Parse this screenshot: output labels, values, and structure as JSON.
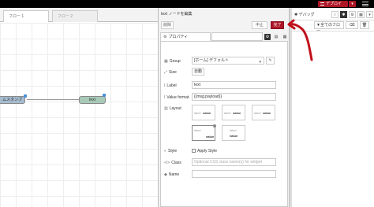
{
  "header": {
    "deploy_label": "デプロイ",
    "deploy_menu_icon": "caret-down-icon",
    "menu_icon": "hamburger-icon"
  },
  "workspace": {
    "tabs": [
      "フロー 1",
      "フロー 2"
    ],
    "nodes": {
      "inject_label": "ムスタンプ",
      "text_label": "text"
    }
  },
  "editor": {
    "title": "text ノードを編集",
    "delete_label": "削除",
    "cancel_label": "中止",
    "done_label": "完了",
    "properties_tab": "プロパティ",
    "fields": {
      "group_label": "Group",
      "group_value": "[ホーム] デフォルト",
      "size_label": "Size",
      "size_value": "自動",
      "label_label": "Label",
      "label_value": "text",
      "value_format_label": "Value format",
      "value_format_value": "{{msg.payload}}",
      "layout_label": "Layout",
      "layout_options": [
        {
          "a": "label",
          "b": "value"
        },
        {
          "a": "label",
          "b": "value"
        },
        {
          "a": "label",
          "b": "value"
        },
        {
          "a": "label",
          "b": "value"
        },
        {
          "a": "label",
          "b": "value"
        }
      ],
      "style_label": "Style",
      "apply_style_label": "Apply Style",
      "class_label": "Class",
      "class_placeholder": "Optional CSS class name(s) for widget",
      "name_label": "Name",
      "name_value": ""
    }
  },
  "sidebar": {
    "title": "デバッグ",
    "filter_label": "全てのフロー",
    "colors": {
      "accent": "#ad1625"
    }
  }
}
